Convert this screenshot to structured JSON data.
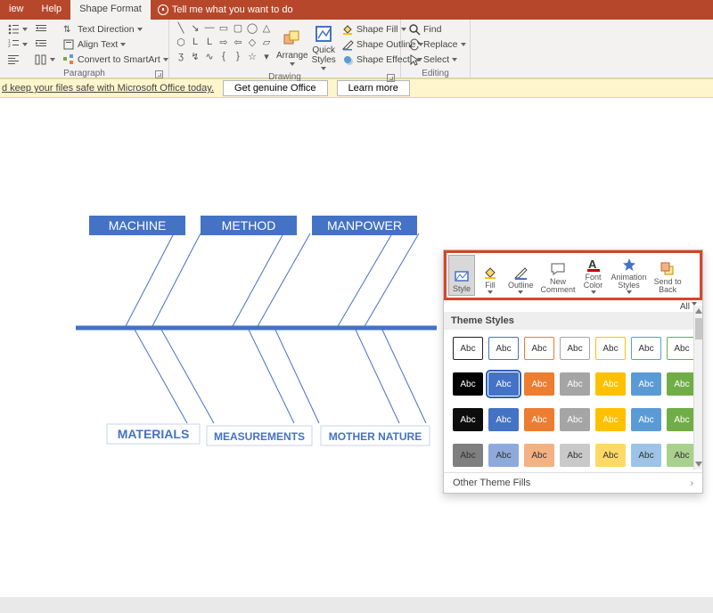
{
  "tabs": {
    "view": "iew",
    "help": "Help",
    "shape_format": "Shape Format",
    "tell_me": "Tell me what you want to do"
  },
  "ribbon": {
    "paragraph": {
      "title": "Paragraph",
      "text_direction": "Text Direction",
      "align_text": "Align Text",
      "convert_smartart": "Convert to SmartArt"
    },
    "drawing": {
      "title": "Drawing",
      "arrange": "Arrange",
      "quick_styles": "Quick\nStyles",
      "shape_fill": "Shape Fill",
      "shape_outline": "Shape Outline",
      "shape_effects": "Shape Effects"
    },
    "editing": {
      "title": "Editing",
      "find": "Find",
      "replace": "Replace",
      "select": "Select"
    }
  },
  "activation": {
    "lead_text": "d keep your files safe with Microsoft Office today.",
    "get_genuine": "Get genuine Office",
    "learn_more": "Learn more"
  },
  "fishbone": {
    "top": [
      "MACHINE",
      "METHOD",
      "MANPOWER"
    ],
    "bottom": [
      "MATERIALS",
      "MEASUREMENTS",
      "MOTHER NATURE"
    ]
  },
  "mini_toolbar": {
    "style": "Style",
    "fill": "Fill",
    "outline": "Outline",
    "new_comment": "New\nComment",
    "font_color": "Font\nColor",
    "animation_styles": "Animation\nStyles",
    "send_to_back": "Send to\nBack",
    "all": "All"
  },
  "theme_styles": {
    "header": "Theme Styles",
    "other_fills": "Other Theme Fills",
    "swatch_label": "Abc",
    "rows": [
      {
        "type": "outline",
        "colors": [
          "#222",
          "#4472c4",
          "#ed7d31",
          "#a5a5a5",
          "#ffc000",
          "#5b9bd5",
          "#70ad47"
        ]
      },
      {
        "type": "solid",
        "colors": [
          "#000000",
          "#4472c4",
          "#ed7d31",
          "#a5a5a5",
          "#ffc000",
          "#5b9bd5",
          "#70ad47"
        ],
        "selected": 1
      },
      {
        "type": "solid",
        "colors": [
          "#0d0d0d",
          "#4472c4",
          "#ed7d31",
          "#a5a5a5",
          "#ffc000",
          "#5b9bd5",
          "#70ad47"
        ]
      },
      {
        "type": "light",
        "colors": [
          "#7f7f7f",
          "#8ea9db",
          "#f4b183",
          "#c9c9c9",
          "#ffd966",
          "#9dc3e6",
          "#a9d18e"
        ]
      }
    ]
  },
  "colors": {
    "brand": "#b7472a",
    "accent": "#4472c4",
    "highlight_border": "#d6452a"
  }
}
